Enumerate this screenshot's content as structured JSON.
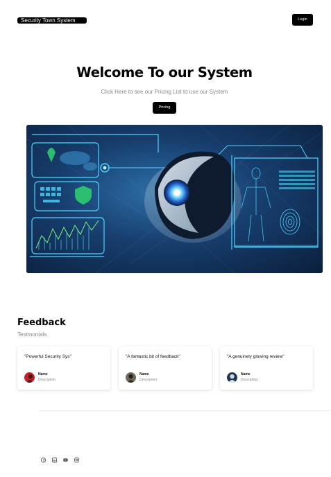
{
  "header": {
    "brand": "Security Town System",
    "login_label": "Login"
  },
  "hero": {
    "title": "Welcome To our System",
    "subtitle": "Click Here to see our Pricing List to use our System",
    "pricing_label": "Pricing"
  },
  "feedback": {
    "title": "Feedback",
    "subtitle": "Testmonials",
    "cards": [
      {
        "quote": "\"Powerful Security Sys\"",
        "name": "Name",
        "description": "Description"
      },
      {
        "quote": "\"A fantastic bit of feedback\"",
        "name": "Name",
        "description": "Description"
      },
      {
        "quote": "\"A genuinely glowing review\"",
        "name": "Name",
        "description": "Description"
      }
    ]
  },
  "footer": {
    "social_icons": [
      "facebook-icon",
      "linkedin-icon",
      "youtube-icon",
      "instagram-icon"
    ]
  },
  "colors": {
    "primary": "#000000",
    "muted_text": "#888888",
    "hud_cyan": "#4fd3ff"
  }
}
